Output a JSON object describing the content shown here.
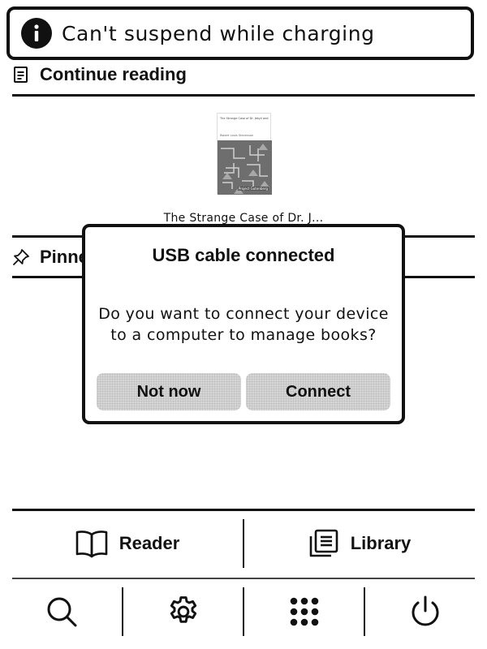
{
  "toast": {
    "message": "Can't suspend while charging",
    "icon": "info-icon"
  },
  "continue_reading": {
    "heading": "Continue reading",
    "icon": "document-icon",
    "book": {
      "title": "The Strange Case of Dr. J...",
      "cover_title": "The Strange Case of Dr. Jekyll and Mr. Hyde",
      "cover_author": "Robert Louis Stevenson",
      "cover_publisher": "Project Gutenberg"
    }
  },
  "pinned": {
    "heading": "Pinne",
    "icon": "pin-icon"
  },
  "dialog": {
    "title": "USB cable connected",
    "message_line1": "Do you want to connect your device",
    "message_line2": "to a computer to manage books?",
    "cancel_label": "Not now",
    "confirm_label": "Connect"
  },
  "nav": {
    "reader_label": "Reader",
    "library_label": "Library"
  },
  "toolbar": {
    "icons": [
      "search-icon",
      "gear-icon",
      "apps-grid-icon",
      "power-icon"
    ]
  }
}
